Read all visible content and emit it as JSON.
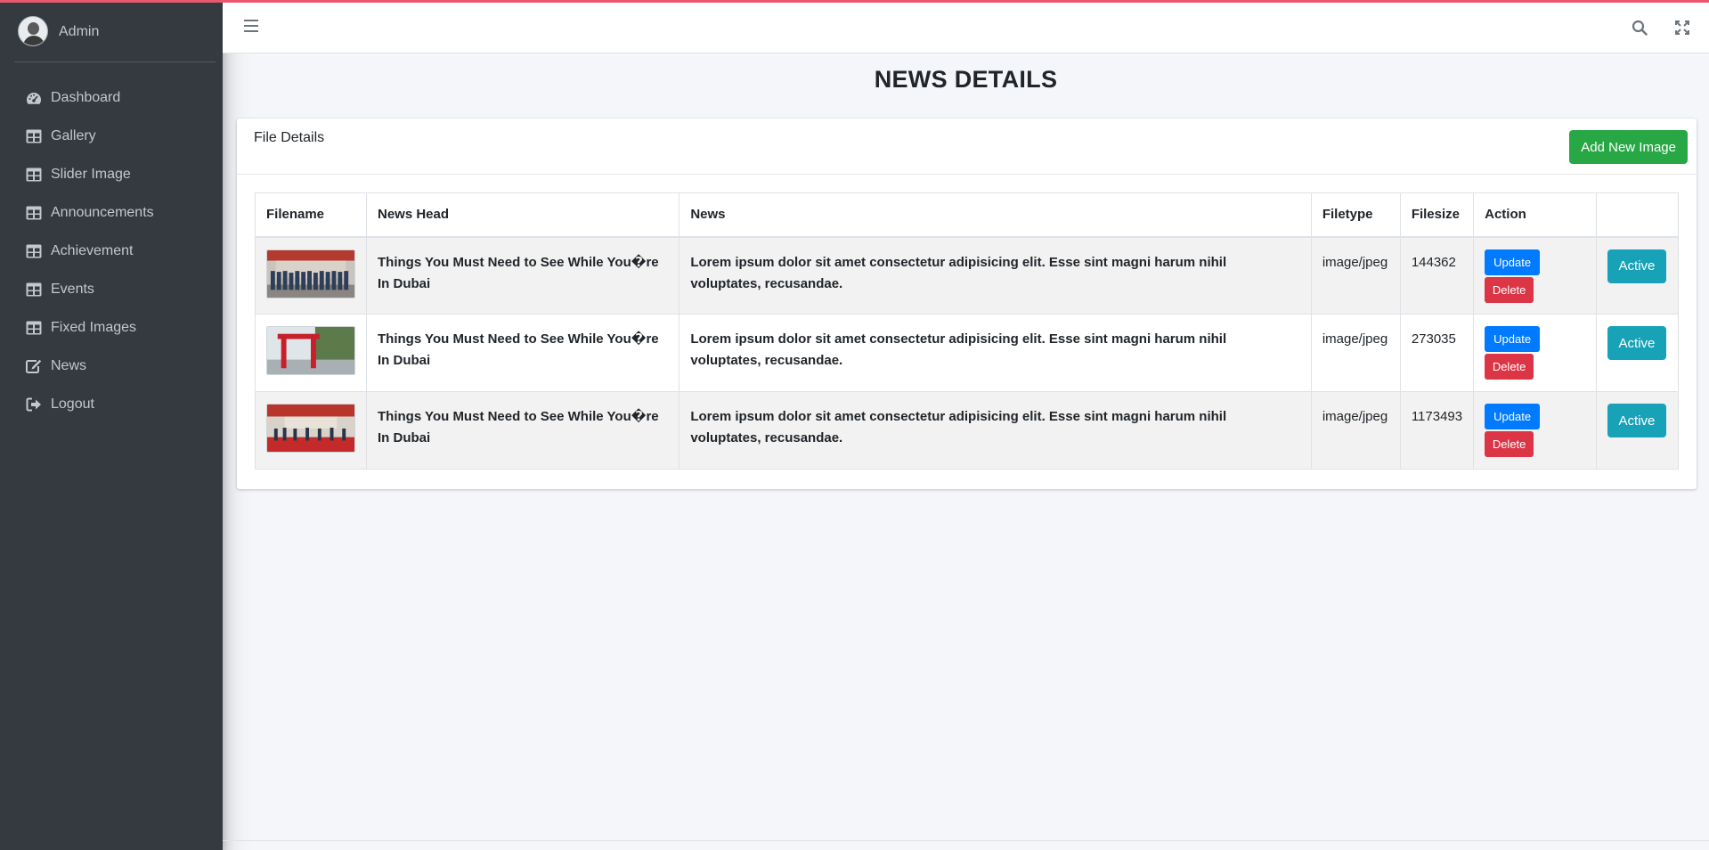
{
  "sidebar": {
    "user": {
      "name": "Admin"
    },
    "items": [
      {
        "label": "Dashboard",
        "icon": "tachometer-icon"
      },
      {
        "label": "Gallery",
        "icon": "table-icon"
      },
      {
        "label": "Slider Image",
        "icon": "table-icon"
      },
      {
        "label": "Announcements",
        "icon": "table-icon"
      },
      {
        "label": "Achievement",
        "icon": "table-icon"
      },
      {
        "label": "Events",
        "icon": "table-icon"
      },
      {
        "label": "Fixed Images",
        "icon": "table-icon"
      },
      {
        "label": "News",
        "icon": "edit-icon"
      },
      {
        "label": "Logout",
        "icon": "sign-out-icon"
      }
    ]
  },
  "topbar": {
    "icons": [
      "menu-icon",
      "search-icon",
      "expand-icon"
    ]
  },
  "page": {
    "title": "NEWS DETAILS"
  },
  "card": {
    "title": "File Details",
    "add_button": "Add New Image"
  },
  "table": {
    "headers": [
      "Filename",
      "News Head",
      "News",
      "Filetype",
      "Filesize",
      "Action",
      ""
    ],
    "rows": [
      {
        "thumb": "group-photo-thumbnail",
        "news_head": "Things You Must Need to See While You�re In Dubai",
        "news": "Lorem ipsum dolor sit amet consectetur adipisicing elit. Esse sint magni harum nihil voluptates, recusandae.",
        "filetype": "image/jpeg",
        "filesize": "144362",
        "update": "Update",
        "delete": "Delete",
        "status": "Active"
      },
      {
        "thumb": "red-arch-thumbnail",
        "news_head": "Things You Must Need to See While You�re In Dubai",
        "news": "Lorem ipsum dolor sit amet consectetur adipisicing elit. Esse sint magni harum nihil voluptates, recusandae.",
        "filetype": "image/jpeg",
        "filesize": "273035",
        "update": "Update",
        "delete": "Delete",
        "status": "Active"
      },
      {
        "thumb": "ceremony-thumbnail",
        "news_head": "Things You Must Need to See While You�re In Dubai",
        "news": "Lorem ipsum dolor sit amet consectetur adipisicing elit. Esse sint magni harum nihil voluptates, recusandae.",
        "filetype": "image/jpeg",
        "filesize": "1173493",
        "update": "Update",
        "delete": "Delete",
        "status": "Active"
      }
    ]
  },
  "colors": {
    "sidebar_bg": "#343a40",
    "accent_top": "#e8586e",
    "success": "#28a745",
    "primary": "#007bff",
    "danger": "#dc3545",
    "info": "#17a2b8"
  }
}
